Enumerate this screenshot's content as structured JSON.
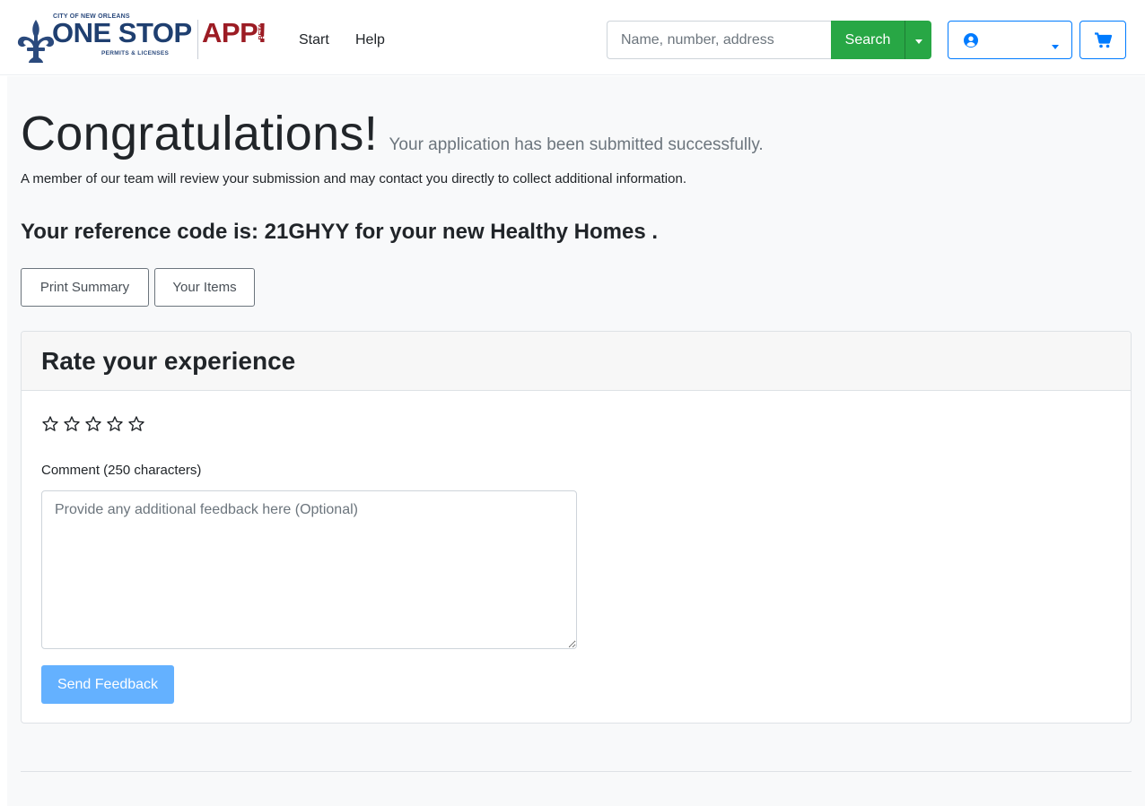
{
  "brand": {
    "city_line": "CITY OF NEW ORLEANS",
    "main": "ONE STOP",
    "app": "APP!",
    "beta": "BETA",
    "sub_line": "PERMITS & LICENSES",
    "colors": {
      "navy": "#1f3f70",
      "red": "#9c1c24"
    }
  },
  "nav": {
    "links": [
      {
        "label": "Start"
      },
      {
        "label": "Help"
      }
    ]
  },
  "search": {
    "placeholder": "Name, number, address",
    "value": "",
    "button_label": "Search",
    "button_color": "#28a745"
  },
  "header_icons": {
    "user": "user-circle-icon",
    "cart": "shopping-cart-icon",
    "accent": "#007bff"
  },
  "confirmation": {
    "title": "Congratulations!",
    "subtitle": "Your application has been submitted successfully.",
    "info": "A member of our team will review your submission and may contact you directly to collect additional information.",
    "reference": "Your reference code is: 21GHYY for your new Healthy Homes ."
  },
  "actions": {
    "print_label": "Print Summary",
    "items_label": "Your Items"
  },
  "feedback": {
    "title": "Rate your experience",
    "rating": 0,
    "rating_max": 5,
    "comment_label": "Comment (250 characters)",
    "comment_placeholder": "Provide any additional feedback here (Optional)",
    "comment_value": "",
    "send_label": "Send Feedback",
    "send_color": "#64b1ff"
  }
}
